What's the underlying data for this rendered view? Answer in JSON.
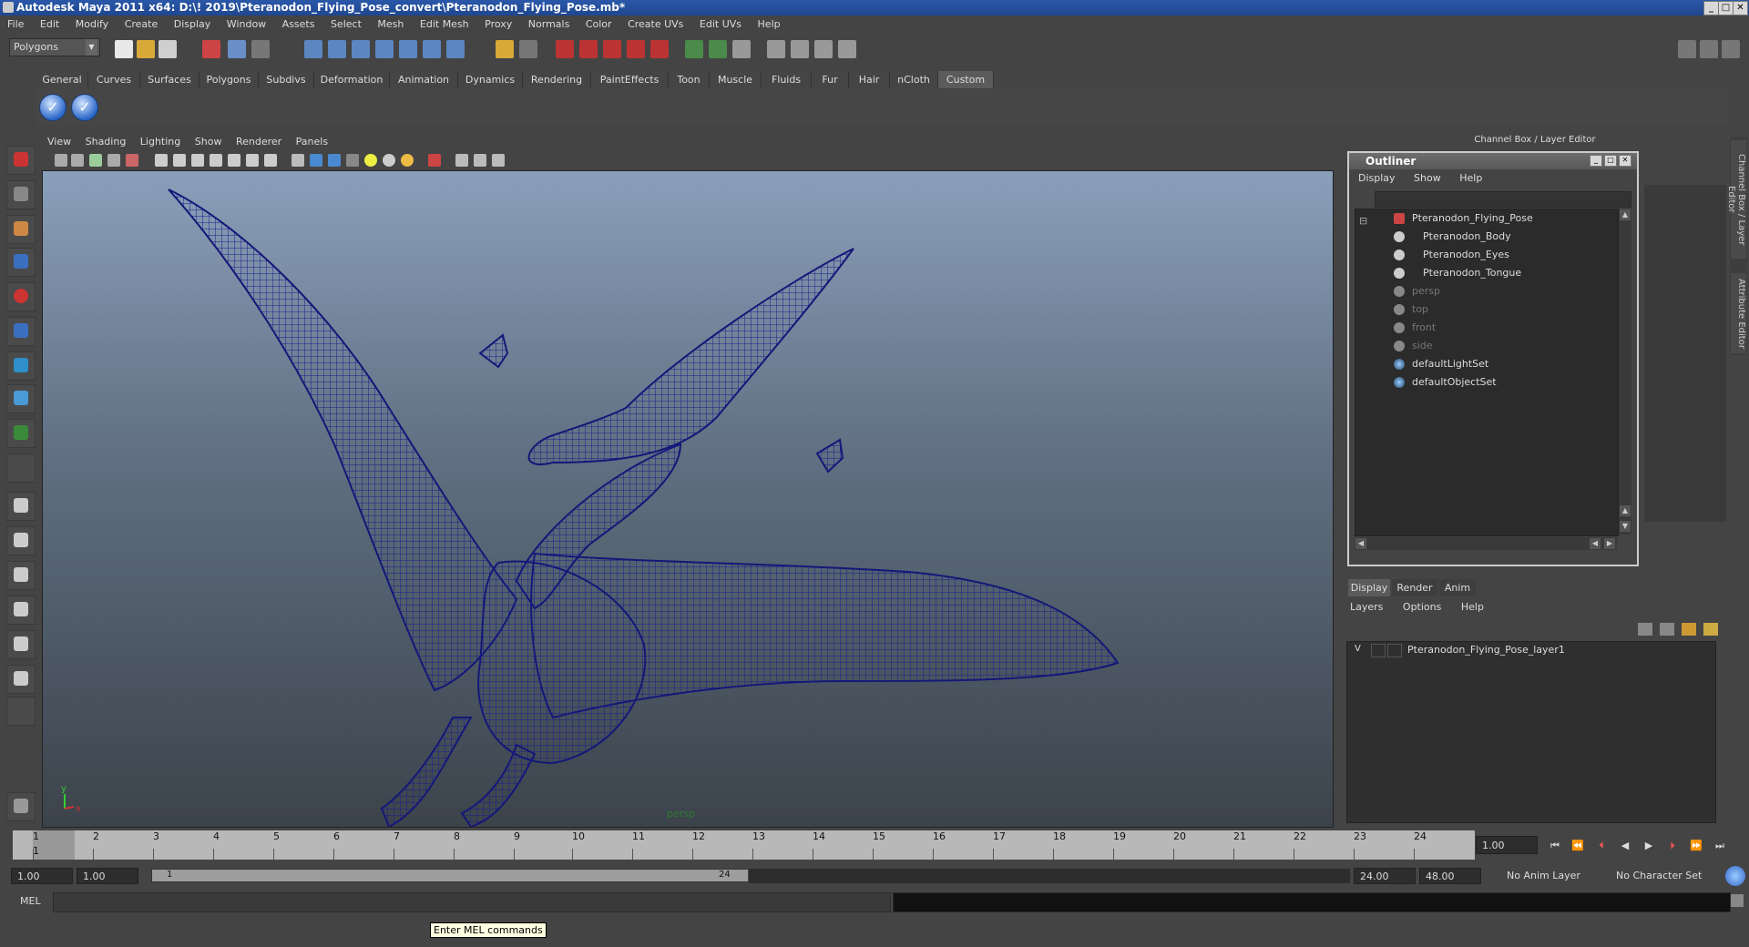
{
  "window": {
    "title": "Autodesk Maya 2011 x64: D:\\! 2019\\Pteranodon_Flying_Pose_convert\\Pteranodon_Flying_Pose.mb*"
  },
  "menubar": [
    "File",
    "Edit",
    "Modify",
    "Create",
    "Display",
    "Window",
    "Assets",
    "Select",
    "Mesh",
    "Edit Mesh",
    "Proxy",
    "Normals",
    "Color",
    "Create UVs",
    "Edit UVs",
    "Help"
  ],
  "statusline": {
    "mode_value": "Polygons"
  },
  "shelf": {
    "tabs": [
      "General",
      "Curves",
      "Surfaces",
      "Polygons",
      "Subdivs",
      "Deformation",
      "Animation",
      "Dynamics",
      "Rendering",
      "PaintEffects",
      "Toon",
      "Muscle",
      "Fluids",
      "Fur",
      "Hair",
      "nCloth",
      "Custom"
    ],
    "active_tab": "Custom"
  },
  "viewport": {
    "menu": [
      "View",
      "Shading",
      "Lighting",
      "Show",
      "Renderer",
      "Panels"
    ],
    "camera_label": "persp",
    "axis_y": "y",
    "axis_x": "x",
    "wireframe_color": "#1a1f8a"
  },
  "channel_box": {
    "title": "Channel Box / Layer Editor"
  },
  "side_tabs": [
    "Channel Box / Layer Editor",
    "Attribute Editor"
  ],
  "outliner": {
    "title": "Outliner",
    "menu": [
      "Display",
      "Show",
      "Help"
    ],
    "items": [
      {
        "label": "Pteranodon_Flying_Pose",
        "kind": "group",
        "dim": false
      },
      {
        "label": "Pteranodon_Body",
        "kind": "mesh",
        "dim": false
      },
      {
        "label": "Pteranodon_Eyes",
        "kind": "mesh",
        "dim": false
      },
      {
        "label": "Pteranodon_Tongue",
        "kind": "mesh",
        "dim": false
      },
      {
        "label": "persp",
        "kind": "camera",
        "dim": true
      },
      {
        "label": "top",
        "kind": "camera",
        "dim": true
      },
      {
        "label": "front",
        "kind": "camera",
        "dim": true
      },
      {
        "label": "side",
        "kind": "camera",
        "dim": true
      },
      {
        "label": "defaultLightSet",
        "kind": "set",
        "dim": false
      },
      {
        "label": "defaultObjectSet",
        "kind": "set",
        "dim": false
      }
    ]
  },
  "layer_editor": {
    "tabs": [
      "Display",
      "Render",
      "Anim"
    ],
    "active_tab": "Display",
    "menu": [
      "Layers",
      "Options",
      "Help"
    ],
    "layers": [
      {
        "visible": "V",
        "name": "Pteranodon_Flying_Pose_layer1"
      }
    ]
  },
  "timeline": {
    "ticks": [
      "1",
      "2",
      "3",
      "4",
      "5",
      "6",
      "7",
      "8",
      "9",
      "10",
      "11",
      "12",
      "13",
      "14",
      "15",
      "16",
      "17",
      "18",
      "19",
      "20",
      "21",
      "22",
      "23",
      "24"
    ],
    "current_frame_marker": "1",
    "current_time": "1.00"
  },
  "range": {
    "start_time": "1.00",
    "playback_start": "1.00",
    "range_start_label": "1",
    "range_end_label": "24",
    "playback_end": "24.00",
    "end_time": "48.00",
    "anim_layer": "No Anim Layer",
    "character_set": "No Character Set"
  },
  "command_line": {
    "label": "MEL"
  },
  "help_line": {
    "tooltip": "Enter MEL commands"
  }
}
